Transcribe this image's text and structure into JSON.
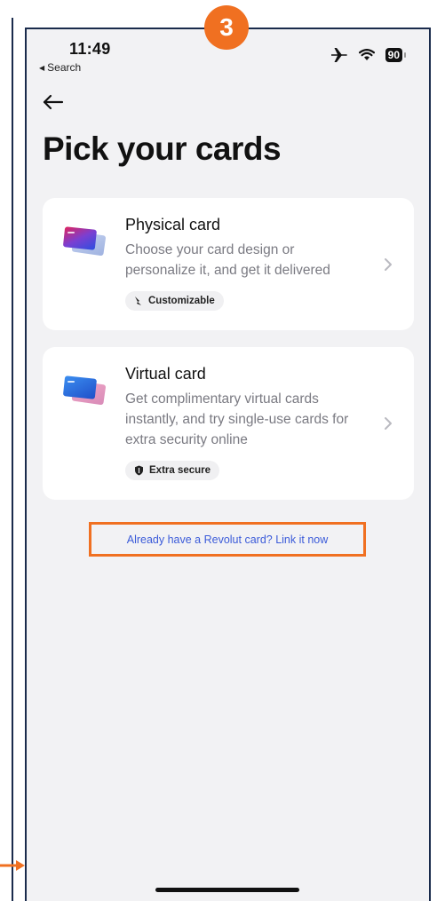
{
  "annotation": {
    "step_number": "3",
    "accent": "#f07021"
  },
  "status_bar": {
    "time": "11:49",
    "back_app": "Search",
    "battery": "90"
  },
  "page": {
    "title": "Pick your cards"
  },
  "cards": [
    {
      "title": "Physical card",
      "description": "Choose your card design or personalize it, and get it delivered",
      "chip": "Customizable",
      "chip_icon": "brush-icon"
    },
    {
      "title": "Virtual card",
      "description": "Get complimentary virtual cards instantly, and try single-use cards for extra security online",
      "chip": "Extra secure",
      "chip_icon": "shield-icon"
    }
  ],
  "link": {
    "label": "Already have a Revolut card? Link it now",
    "color": "#3b5bd9"
  }
}
